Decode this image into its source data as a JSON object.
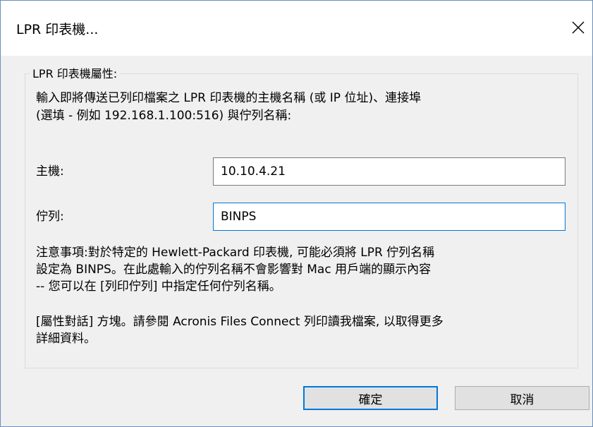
{
  "window": {
    "title": "LPR 印表機...",
    "close_icon": "close-icon"
  },
  "group": {
    "legend": "LPR 印表機屬性:",
    "instruction_line1": "輸入即將傳送已列印檔案之 LPR 印表機的主機名稱 (或 IP 位址)、連接埠",
    "instruction_line2": "(選填 - 例如 192.168.1.100:516) 與佇列名稱:"
  },
  "fields": {
    "host_label": "主機:",
    "host_value": "10.10.4.21",
    "queue_label": "佇列:",
    "queue_value": "BINPS"
  },
  "note": {
    "line1": "注意事項:對於特定的 Hewlett-Packard 印表機, 可能必須將 LPR 佇列名稱",
    "line2": "設定為 BINPS。在此處輸入的佇列名稱不會影響對 Mac 用戶端的顯示內容",
    "line3": "-- 您可以在 [列印佇列] 中指定任何佇列名稱。"
  },
  "info": {
    "line1": "[屬性對話] 方塊。請參閱 Acronis Files Connect 列印讀我檔案, 以取得更多",
    "line2": "詳細資料。"
  },
  "buttons": {
    "ok_label": "確定",
    "cancel_label": "取消"
  },
  "colors": {
    "accent": "#0078d7",
    "window_border": "#6a8fb8",
    "dialog_bg": "#f0f0f0"
  }
}
